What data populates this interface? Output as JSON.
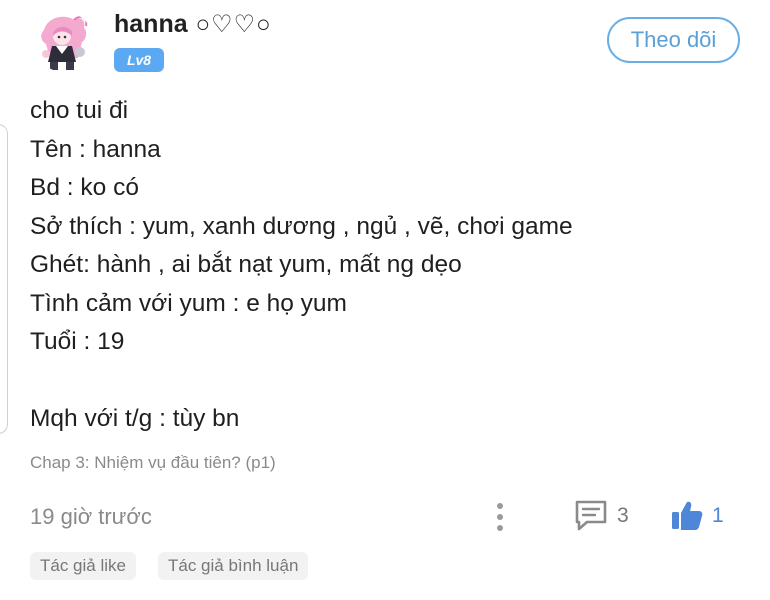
{
  "user": {
    "name": "hanna",
    "name_decoration": "○♡♡○",
    "level_badge": "Lv8",
    "follow_label": "Theo dõi"
  },
  "comment": {
    "lines": [
      "cho tui đi",
      "Tên : hanna",
      "Bd : ko có",
      "Sở thích : yum,  xanh dương , ngủ , vẽ, chơi game",
      "Ghét: hành , ai bắt nạt yum,  mất ng dẹo",
      "Tình cảm với yum : e họ yum",
      "Tuổi : 19",
      "",
      "Mqh với t/g : tùy bn"
    ],
    "chapter": "Chap 3: Nhiệm vụ đầu tiên? (p1)",
    "time": "19 giờ trước",
    "reply_count": "3",
    "like_count": "1"
  },
  "tags": [
    "Tác giả like",
    "Tác giả bình luận"
  ],
  "colors": {
    "accent": "#5aa9f2",
    "follow_border": "#6aaee6",
    "like_blue": "#4e86d8",
    "muted_text": "#8a8a8a",
    "tag_bg": "#f2f2f2"
  },
  "icons": {
    "more": "vertical-dots-icon",
    "reply": "speech-bubble-icon",
    "like": "thumbs-up-icon"
  }
}
